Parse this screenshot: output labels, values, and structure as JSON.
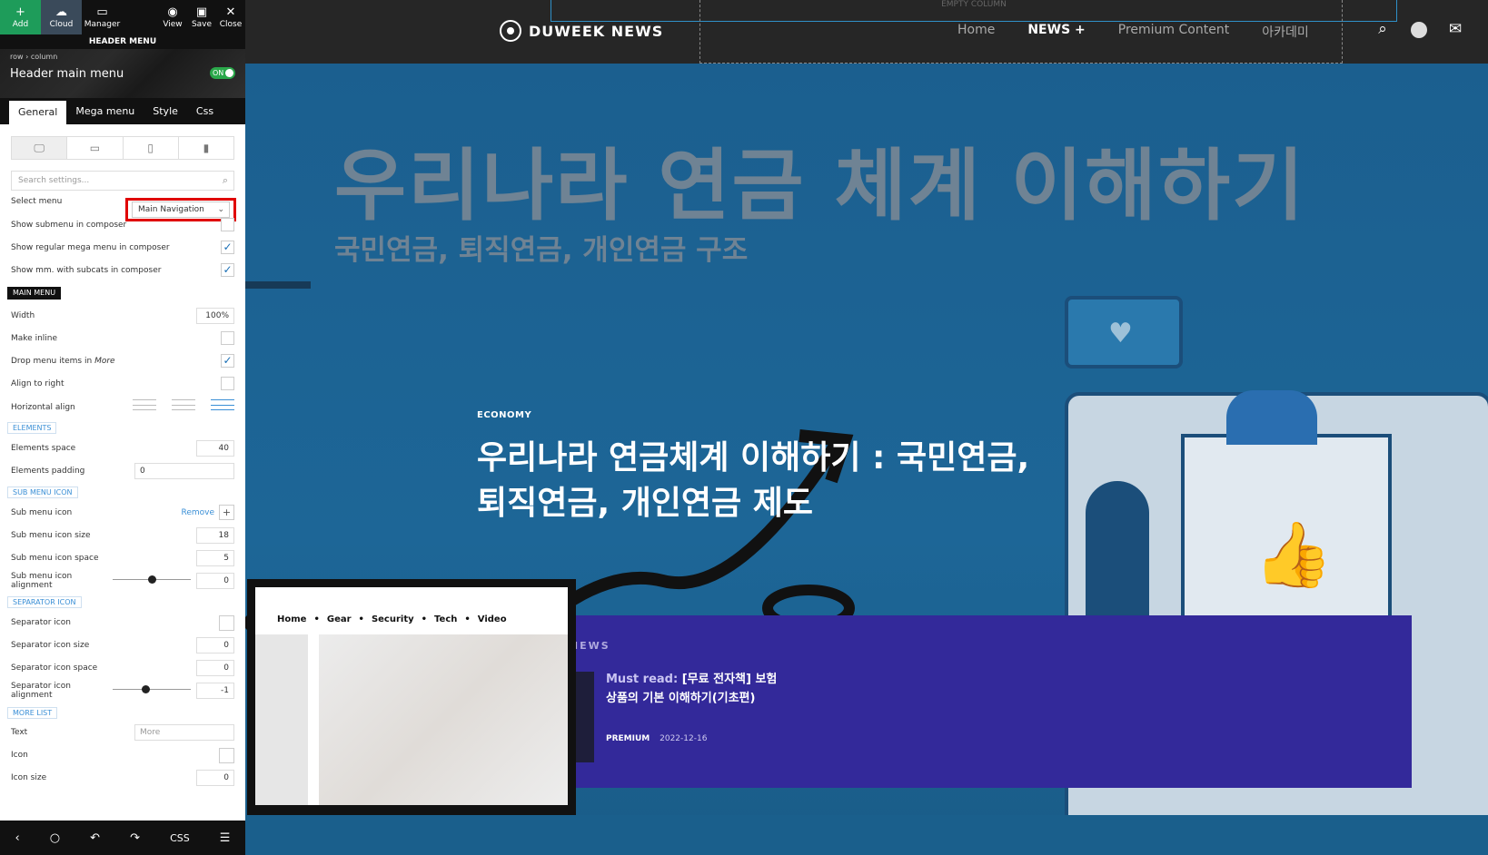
{
  "toolbar": {
    "add": "Add",
    "cloud": "Cloud",
    "manager": "Manager",
    "view": "View",
    "save": "Save",
    "close": "Close",
    "section_title": "HEADER MENU"
  },
  "element": {
    "crumbs": "row › column",
    "title": "Header main menu",
    "toggle": "ON"
  },
  "tabs": [
    "General",
    "Mega menu",
    "Style",
    "Css"
  ],
  "search": {
    "placeholder": "Search settings..."
  },
  "settings": {
    "select_menu_label": "Select menu",
    "select_menu_value": "Main Navigation",
    "show_submenu": "Show submenu in composer",
    "show_regular_mega": "Show regular mega menu in composer",
    "show_mm_subcats": "Show mm. with subcats in composer",
    "main_menu_section": "MAIN MENU",
    "width_label": "Width",
    "width_value": "100%",
    "make_inline": "Make inline",
    "drop_menu_items": "Drop menu items in",
    "drop_menu_more": "More",
    "align_right": "Align to right",
    "horizontal_align": "Horizontal align",
    "elements_section": "ELEMENTS",
    "elements_space_label": "Elements space",
    "elements_space_value": "40",
    "elements_padding_label": "Elements padding",
    "elements_padding_value": "0",
    "sub_menu_icon_section": "SUB MENU ICON",
    "sub_menu_icon_label": "Sub menu icon",
    "remove": "Remove",
    "sub_menu_icon_size_label": "Sub menu icon size",
    "sub_menu_icon_size_value": "18",
    "sub_menu_icon_space_label": "Sub menu icon space",
    "sub_menu_icon_space_value": "5",
    "sub_menu_icon_align_label": "Sub menu icon alignment",
    "sub_menu_icon_align_value": "0",
    "separator_icon_section": "SEPARATOR ICON",
    "separator_icon_label": "Separator icon",
    "separator_icon_size_label": "Separator icon size",
    "separator_icon_size_value": "0",
    "separator_icon_space_label": "Separator icon space",
    "separator_icon_space_value": "0",
    "separator_icon_align_label": "Separator icon alignment",
    "separator_icon_align_value": "-1",
    "more_list_section": "MORE LIST",
    "text_label": "Text",
    "text_placeholder": "More",
    "icon_label": "Icon",
    "icon_size_label": "Icon size",
    "icon_size_value": "0"
  },
  "bottombar": {
    "css": "CSS"
  },
  "site": {
    "empty_column": "EMPTY COLUMN",
    "logo": "DUWEEK NEWS",
    "nav": [
      "Home",
      "NEWS +",
      "Premium Content",
      "아카데미"
    ],
    "hero_big": "우리나라 연금 체계 이해하기",
    "hero_sub": "국민연금, 퇴직연금, 개인연금 구조",
    "category": "ECONOMY",
    "headline": "우리나라 연금체계 이해하기 : 국민연금, 퇴직연금, 개인연금 제도",
    "news_label": "IEWS",
    "must_read": "Must read:",
    "must_read_title": "[무료 전자책] 보험 상품의 기본 이해하기(기초편)",
    "premium_badge": "PREMIUM",
    "date": "2022-12-16"
  },
  "mega": {
    "items": [
      "Home",
      "Gear",
      "Security",
      "Tech",
      "Video"
    ]
  },
  "colors": {
    "accent_green": "#1e9c5a",
    "highlight_red": "#e00000",
    "news_purple": "#33299a",
    "link_blue": "#3a8fd6"
  },
  "levels": {
    "sub_menu_icon_alignment_slider": 0.5,
    "separator_icon_alignment_slider": 0.42
  }
}
